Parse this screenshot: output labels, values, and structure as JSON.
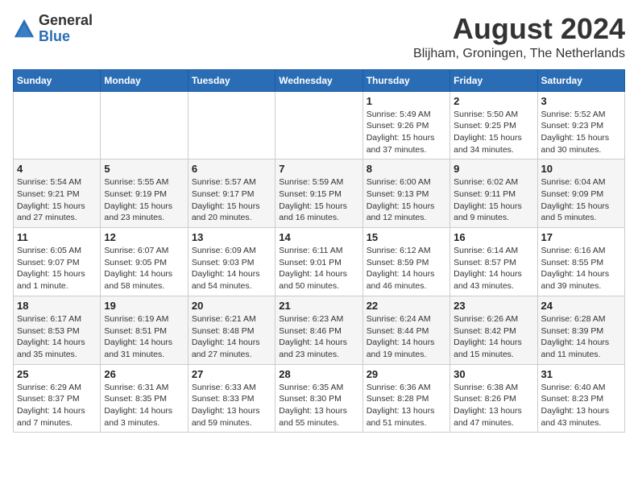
{
  "logo": {
    "general": "General",
    "blue": "Blue"
  },
  "header": {
    "month_year": "August 2024",
    "location": "Blijham, Groningen, The Netherlands"
  },
  "weekdays": [
    "Sunday",
    "Monday",
    "Tuesday",
    "Wednesday",
    "Thursday",
    "Friday",
    "Saturday"
  ],
  "weeks": [
    [
      {
        "day": "",
        "info": ""
      },
      {
        "day": "",
        "info": ""
      },
      {
        "day": "",
        "info": ""
      },
      {
        "day": "",
        "info": ""
      },
      {
        "day": "1",
        "info": "Sunrise: 5:49 AM\nSunset: 9:26 PM\nDaylight: 15 hours\nand 37 minutes."
      },
      {
        "day": "2",
        "info": "Sunrise: 5:50 AM\nSunset: 9:25 PM\nDaylight: 15 hours\nand 34 minutes."
      },
      {
        "day": "3",
        "info": "Sunrise: 5:52 AM\nSunset: 9:23 PM\nDaylight: 15 hours\nand 30 minutes."
      }
    ],
    [
      {
        "day": "4",
        "info": "Sunrise: 5:54 AM\nSunset: 9:21 PM\nDaylight: 15 hours\nand 27 minutes."
      },
      {
        "day": "5",
        "info": "Sunrise: 5:55 AM\nSunset: 9:19 PM\nDaylight: 15 hours\nand 23 minutes."
      },
      {
        "day": "6",
        "info": "Sunrise: 5:57 AM\nSunset: 9:17 PM\nDaylight: 15 hours\nand 20 minutes."
      },
      {
        "day": "7",
        "info": "Sunrise: 5:59 AM\nSunset: 9:15 PM\nDaylight: 15 hours\nand 16 minutes."
      },
      {
        "day": "8",
        "info": "Sunrise: 6:00 AM\nSunset: 9:13 PM\nDaylight: 15 hours\nand 12 minutes."
      },
      {
        "day": "9",
        "info": "Sunrise: 6:02 AM\nSunset: 9:11 PM\nDaylight: 15 hours\nand 9 minutes."
      },
      {
        "day": "10",
        "info": "Sunrise: 6:04 AM\nSunset: 9:09 PM\nDaylight: 15 hours\nand 5 minutes."
      }
    ],
    [
      {
        "day": "11",
        "info": "Sunrise: 6:05 AM\nSunset: 9:07 PM\nDaylight: 15 hours\nand 1 minute."
      },
      {
        "day": "12",
        "info": "Sunrise: 6:07 AM\nSunset: 9:05 PM\nDaylight: 14 hours\nand 58 minutes."
      },
      {
        "day": "13",
        "info": "Sunrise: 6:09 AM\nSunset: 9:03 PM\nDaylight: 14 hours\nand 54 minutes."
      },
      {
        "day": "14",
        "info": "Sunrise: 6:11 AM\nSunset: 9:01 PM\nDaylight: 14 hours\nand 50 minutes."
      },
      {
        "day": "15",
        "info": "Sunrise: 6:12 AM\nSunset: 8:59 PM\nDaylight: 14 hours\nand 46 minutes."
      },
      {
        "day": "16",
        "info": "Sunrise: 6:14 AM\nSunset: 8:57 PM\nDaylight: 14 hours\nand 43 minutes."
      },
      {
        "day": "17",
        "info": "Sunrise: 6:16 AM\nSunset: 8:55 PM\nDaylight: 14 hours\nand 39 minutes."
      }
    ],
    [
      {
        "day": "18",
        "info": "Sunrise: 6:17 AM\nSunset: 8:53 PM\nDaylight: 14 hours\nand 35 minutes."
      },
      {
        "day": "19",
        "info": "Sunrise: 6:19 AM\nSunset: 8:51 PM\nDaylight: 14 hours\nand 31 minutes."
      },
      {
        "day": "20",
        "info": "Sunrise: 6:21 AM\nSunset: 8:48 PM\nDaylight: 14 hours\nand 27 minutes."
      },
      {
        "day": "21",
        "info": "Sunrise: 6:23 AM\nSunset: 8:46 PM\nDaylight: 14 hours\nand 23 minutes."
      },
      {
        "day": "22",
        "info": "Sunrise: 6:24 AM\nSunset: 8:44 PM\nDaylight: 14 hours\nand 19 minutes."
      },
      {
        "day": "23",
        "info": "Sunrise: 6:26 AM\nSunset: 8:42 PM\nDaylight: 14 hours\nand 15 minutes."
      },
      {
        "day": "24",
        "info": "Sunrise: 6:28 AM\nSunset: 8:39 PM\nDaylight: 14 hours\nand 11 minutes."
      }
    ],
    [
      {
        "day": "25",
        "info": "Sunrise: 6:29 AM\nSunset: 8:37 PM\nDaylight: 14 hours\nand 7 minutes."
      },
      {
        "day": "26",
        "info": "Sunrise: 6:31 AM\nSunset: 8:35 PM\nDaylight: 14 hours\nand 3 minutes."
      },
      {
        "day": "27",
        "info": "Sunrise: 6:33 AM\nSunset: 8:33 PM\nDaylight: 13 hours\nand 59 minutes."
      },
      {
        "day": "28",
        "info": "Sunrise: 6:35 AM\nSunset: 8:30 PM\nDaylight: 13 hours\nand 55 minutes."
      },
      {
        "day": "29",
        "info": "Sunrise: 6:36 AM\nSunset: 8:28 PM\nDaylight: 13 hours\nand 51 minutes."
      },
      {
        "day": "30",
        "info": "Sunrise: 6:38 AM\nSunset: 8:26 PM\nDaylight: 13 hours\nand 47 minutes."
      },
      {
        "day": "31",
        "info": "Sunrise: 6:40 AM\nSunset: 8:23 PM\nDaylight: 13 hours\nand 43 minutes."
      }
    ]
  ]
}
